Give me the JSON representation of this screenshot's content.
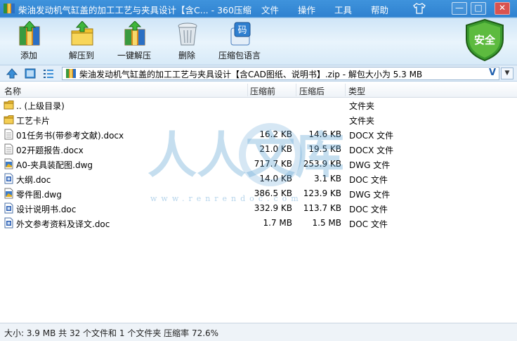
{
  "window": {
    "title": "柴油发动机气缸盖的加工工艺与夹具设计【含C... - 360压缩",
    "menu": [
      "文件",
      "操作",
      "工具",
      "帮助"
    ],
    "controls": {
      "minimize": "—",
      "maximize": "□",
      "close": "✕"
    }
  },
  "toolbar": {
    "items": [
      {
        "label": "添加",
        "icon": "add-archive-icon"
      },
      {
        "label": "解压到",
        "icon": "extract-to-icon"
      },
      {
        "label": "一键解压",
        "icon": "one-click-extract-icon"
      },
      {
        "label": "删除",
        "icon": "delete-trash-icon"
      },
      {
        "label": "压缩包语言",
        "icon": "archive-language-icon"
      }
    ],
    "language_glyph": "码",
    "safe_label": "安全"
  },
  "address": {
    "path": "柴油发动机气缸盖的加工工艺与夹具设计【含CAD图纸、说明书】.zip - 解包大小为 5.3 MB",
    "v_label": "V",
    "dropdown": "▼"
  },
  "columns": {
    "name": "名称",
    "packed": "压缩前",
    "unpacked": "压缩后",
    "type": "类型"
  },
  "files": [
    {
      "name": ".. (上级目录)",
      "packed": "",
      "unpacked": "",
      "type": "文件夹",
      "icon": "folder"
    },
    {
      "name": "工艺卡片",
      "packed": "",
      "unpacked": "",
      "type": "文件夹",
      "icon": "folder"
    },
    {
      "name": "01任务书(带参考文献).docx",
      "packed": "16.2 KB",
      "unpacked": "14.6 KB",
      "type": "DOCX 文件",
      "icon": "text"
    },
    {
      "name": "02开题报告.docx",
      "packed": "21.0 KB",
      "unpacked": "19.5 KB",
      "type": "DOCX 文件",
      "icon": "text"
    },
    {
      "name": "A0-夹具装配图.dwg",
      "packed": "717.7 KB",
      "unpacked": "253.9 KB",
      "type": "DWG 文件",
      "icon": "dwg"
    },
    {
      "name": "大纲.doc",
      "packed": "14.0 KB",
      "unpacked": "3.1 KB",
      "type": "DOC 文件",
      "icon": "doc"
    },
    {
      "name": "零件图.dwg",
      "packed": "386.5 KB",
      "unpacked": "123.9 KB",
      "type": "DWG 文件",
      "icon": "dwg"
    },
    {
      "name": "设计说明书.doc",
      "packed": "332.9 KB",
      "unpacked": "113.7 KB",
      "type": "DOC 文件",
      "icon": "doc"
    },
    {
      "name": "外文参考资料及译文.doc",
      "packed": "1.7 MB",
      "unpacked": "1.5 MB",
      "type": "DOC 文件",
      "icon": "doc"
    }
  ],
  "watermark": {
    "text": "人人文库",
    "url": "www.renrendoc.com"
  },
  "status": "大小: 3.9 MB 共 32 个文件和 1 个文件夹 压缩率 72.6%"
}
